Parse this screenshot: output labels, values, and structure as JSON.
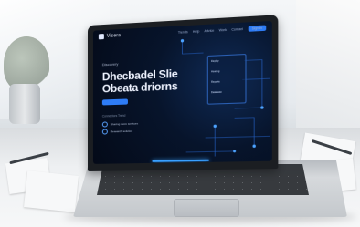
{
  "scene": {
    "description_free_ui": true
  },
  "laptop_screen": {
    "brand": "Visera",
    "nav_items": [
      "Trends",
      "Help",
      "Advice",
      "Work",
      "Contact"
    ],
    "nav_cta": "Sign in",
    "eyebrow": "Discovery",
    "headline_line1": "Dhecbadel Slie",
    "headline_line2": "Obeata driorns",
    "primary_button": "",
    "mini_heading": "Connectors Trend",
    "rows": [
      "Sharing more services",
      "Research solution"
    ],
    "panel_labels": [
      "Deploy",
      "Hosting",
      "Reports",
      "Database"
    ],
    "panel_values": [
      "",
      "",
      "",
      ""
    ],
    "accent_color": "#2e7cf6"
  }
}
